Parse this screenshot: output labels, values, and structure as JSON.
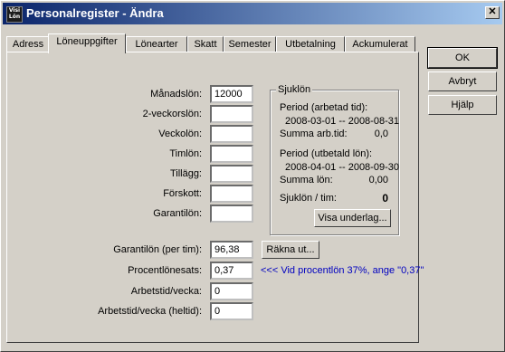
{
  "window": {
    "title": "Personalregister - Ändra",
    "icon_top": "Visi",
    "icon_bottom": "Lön",
    "close_symbol": "✕"
  },
  "tabs": [
    {
      "label": "Adress"
    },
    {
      "label": "Löneuppgifter",
      "active": true
    },
    {
      "label": "Lönearter"
    },
    {
      "label": "Skatt"
    },
    {
      "label": "Semester"
    },
    {
      "label": "Utbetalning"
    },
    {
      "label": "Ackumulerat"
    }
  ],
  "buttons": {
    "ok": "OK",
    "cancel": "Avbryt",
    "help": "Hjälp",
    "calculate": "Räkna ut...",
    "show_basis": "Visa underlag..."
  },
  "salary_fields": [
    {
      "label": "Månadslön:",
      "value": "12000"
    },
    {
      "label": "2-veckorslön:",
      "value": ""
    },
    {
      "label": "Veckolön:",
      "value": ""
    },
    {
      "label": "Timlön:",
      "value": ""
    },
    {
      "label": "Tillägg:",
      "value": ""
    },
    {
      "label": "Förskott:",
      "value": ""
    },
    {
      "label": "Garantilön:",
      "value": ""
    }
  ],
  "sick_pay": {
    "title": "Sjuklön",
    "period_worked_label": "Period (arbetad tid):",
    "period_worked_range": "2008-03-01  --  2008-08-31",
    "sum_worktime_label": "Summa arb.tid:",
    "sum_worktime_value": "0,0",
    "period_paid_label": "Period (utbetald lön):",
    "period_paid_range": "2008-04-01  --  2008-09-30",
    "sum_salary_label": "Summa lön:",
    "sum_salary_value": "0,00",
    "per_hour_label": "Sjuklön / tim:",
    "per_hour_value": "0"
  },
  "lower_fields": {
    "guarantee_per_hour_label": "Garantilön (per tim):",
    "guarantee_per_hour_value": "96,38",
    "percent_label": "Procentlönesats:",
    "percent_value": "0,37",
    "percent_hint": "<<< Vid procentlön 37%, ange \"0,37\"",
    "weekly_hours_label": "Arbetstid/vecka:",
    "weekly_hours_value": "0",
    "weekly_hours_full_label": "Arbetstid/vecka (heltid):",
    "weekly_hours_full_value": "0"
  }
}
